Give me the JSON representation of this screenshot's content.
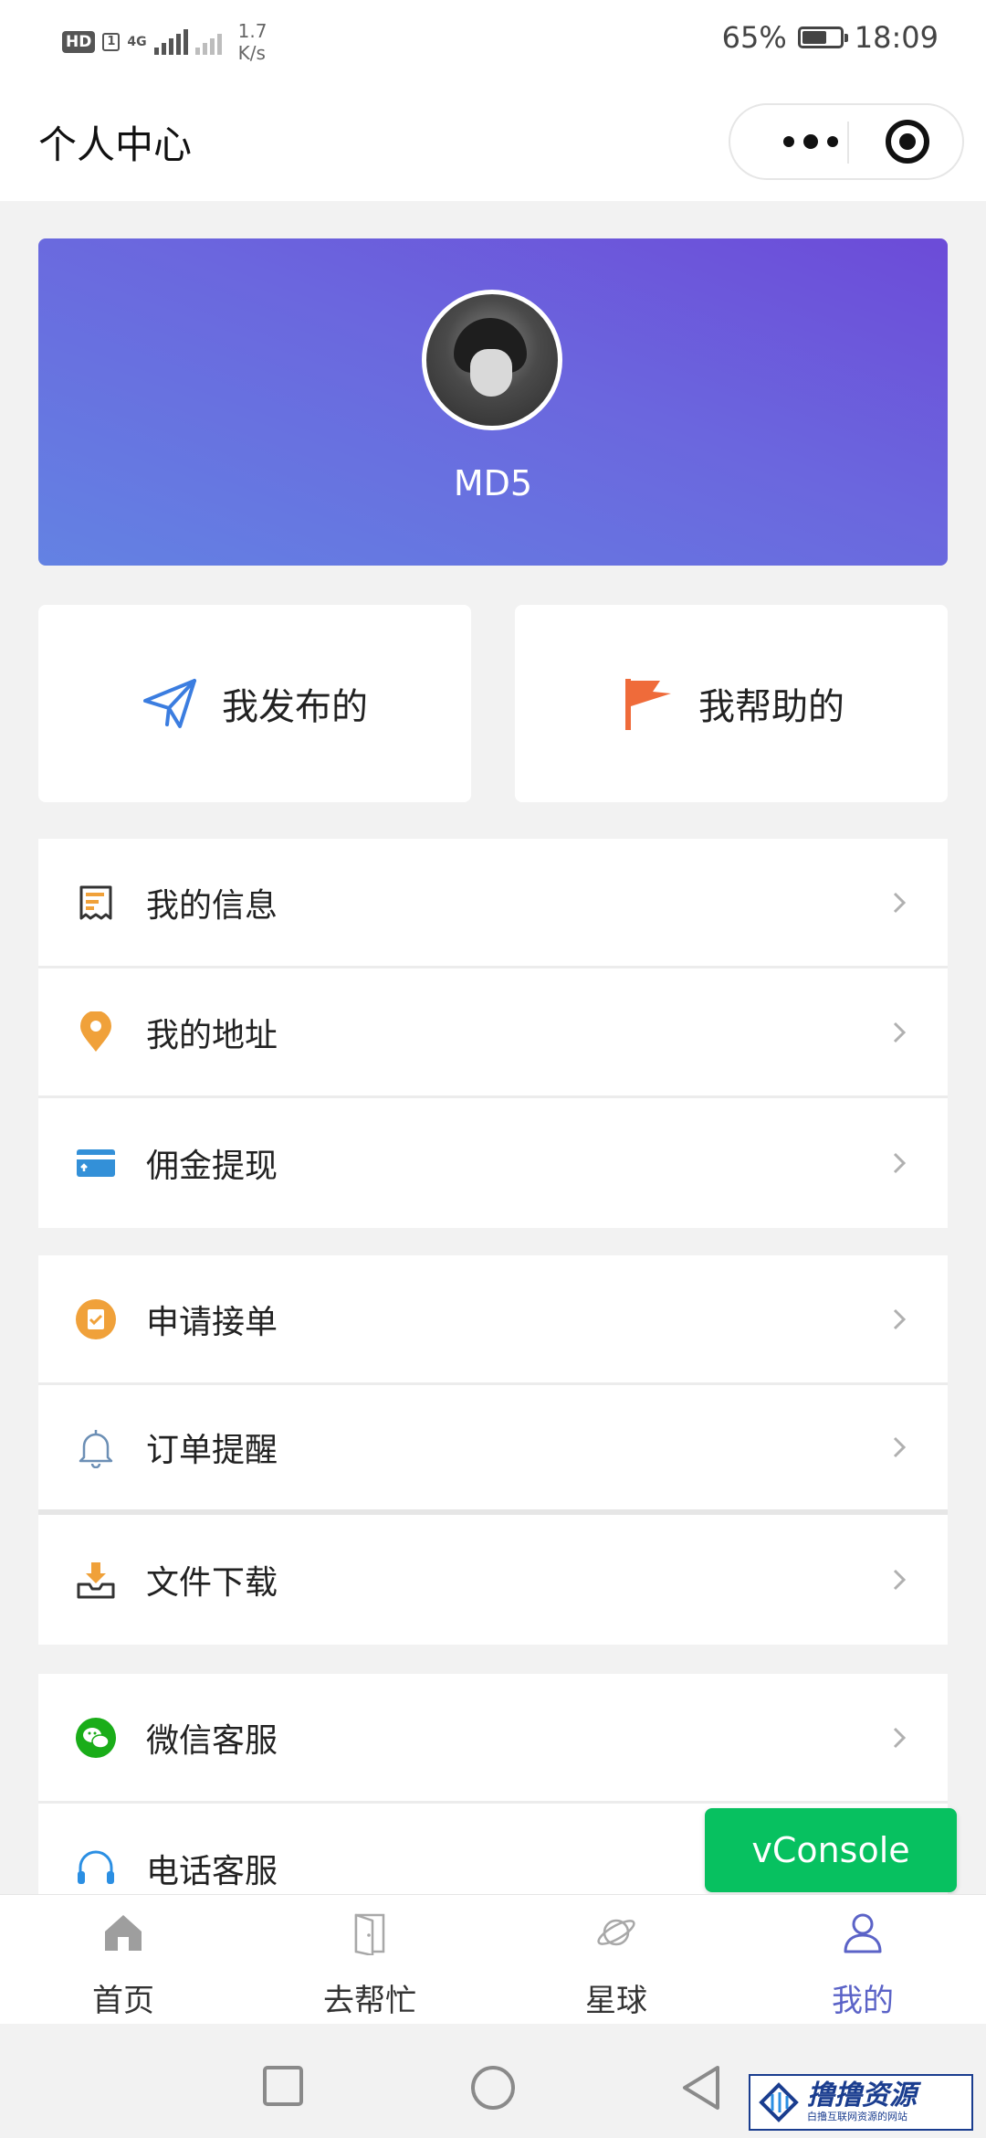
{
  "status_bar": {
    "hd": "HD",
    "sim": "1",
    "network": "4G",
    "speed_value": "1.7",
    "speed_unit": "K/s",
    "battery": "65%",
    "time": "18:09"
  },
  "header": {
    "title": "个人中心"
  },
  "profile": {
    "username": "MD5"
  },
  "quick_actions": [
    {
      "label": "我发布的",
      "icon": "paper-plane-icon"
    },
    {
      "label": "我帮助的",
      "icon": "flag-icon"
    }
  ],
  "menu_groups": [
    [
      {
        "label": "我的信息",
        "icon": "receipt-icon"
      },
      {
        "label": "我的地址",
        "icon": "location-pin-icon"
      },
      {
        "label": "佣金提现",
        "icon": "card-icon"
      }
    ],
    [
      {
        "label": "申请接单",
        "icon": "clipboard-check-icon"
      },
      {
        "label": "订单提醒",
        "icon": "bell-icon"
      },
      {
        "label": "文件下载",
        "icon": "download-tray-icon"
      }
    ],
    [
      {
        "label": "微信客服",
        "icon": "wechat-icon"
      },
      {
        "label": "电话客服",
        "icon": "headset-icon"
      }
    ]
  ],
  "vconsole": "vConsole",
  "tabbar": {
    "tabs": [
      {
        "label": "首页",
        "icon": "home-icon"
      },
      {
        "label": "去帮忙",
        "icon": "door-icon"
      },
      {
        "label": "星球",
        "icon": "planet-icon"
      },
      {
        "label": "我的",
        "icon": "user-icon"
      }
    ],
    "active_index": 3
  },
  "watermark": {
    "title": "撸撸资源",
    "subtitle": "白撸互联网资源的网站"
  },
  "colors": {
    "accent": "#5b63c7",
    "profile_gradient_start": "#6382e3",
    "profile_gradient_end": "#6c4bd8",
    "vconsole": "#07c160",
    "wechat": "#1aad19",
    "orange": "#f0a13a",
    "flag": "#ef6b3a",
    "plane": "#3b7de0"
  }
}
